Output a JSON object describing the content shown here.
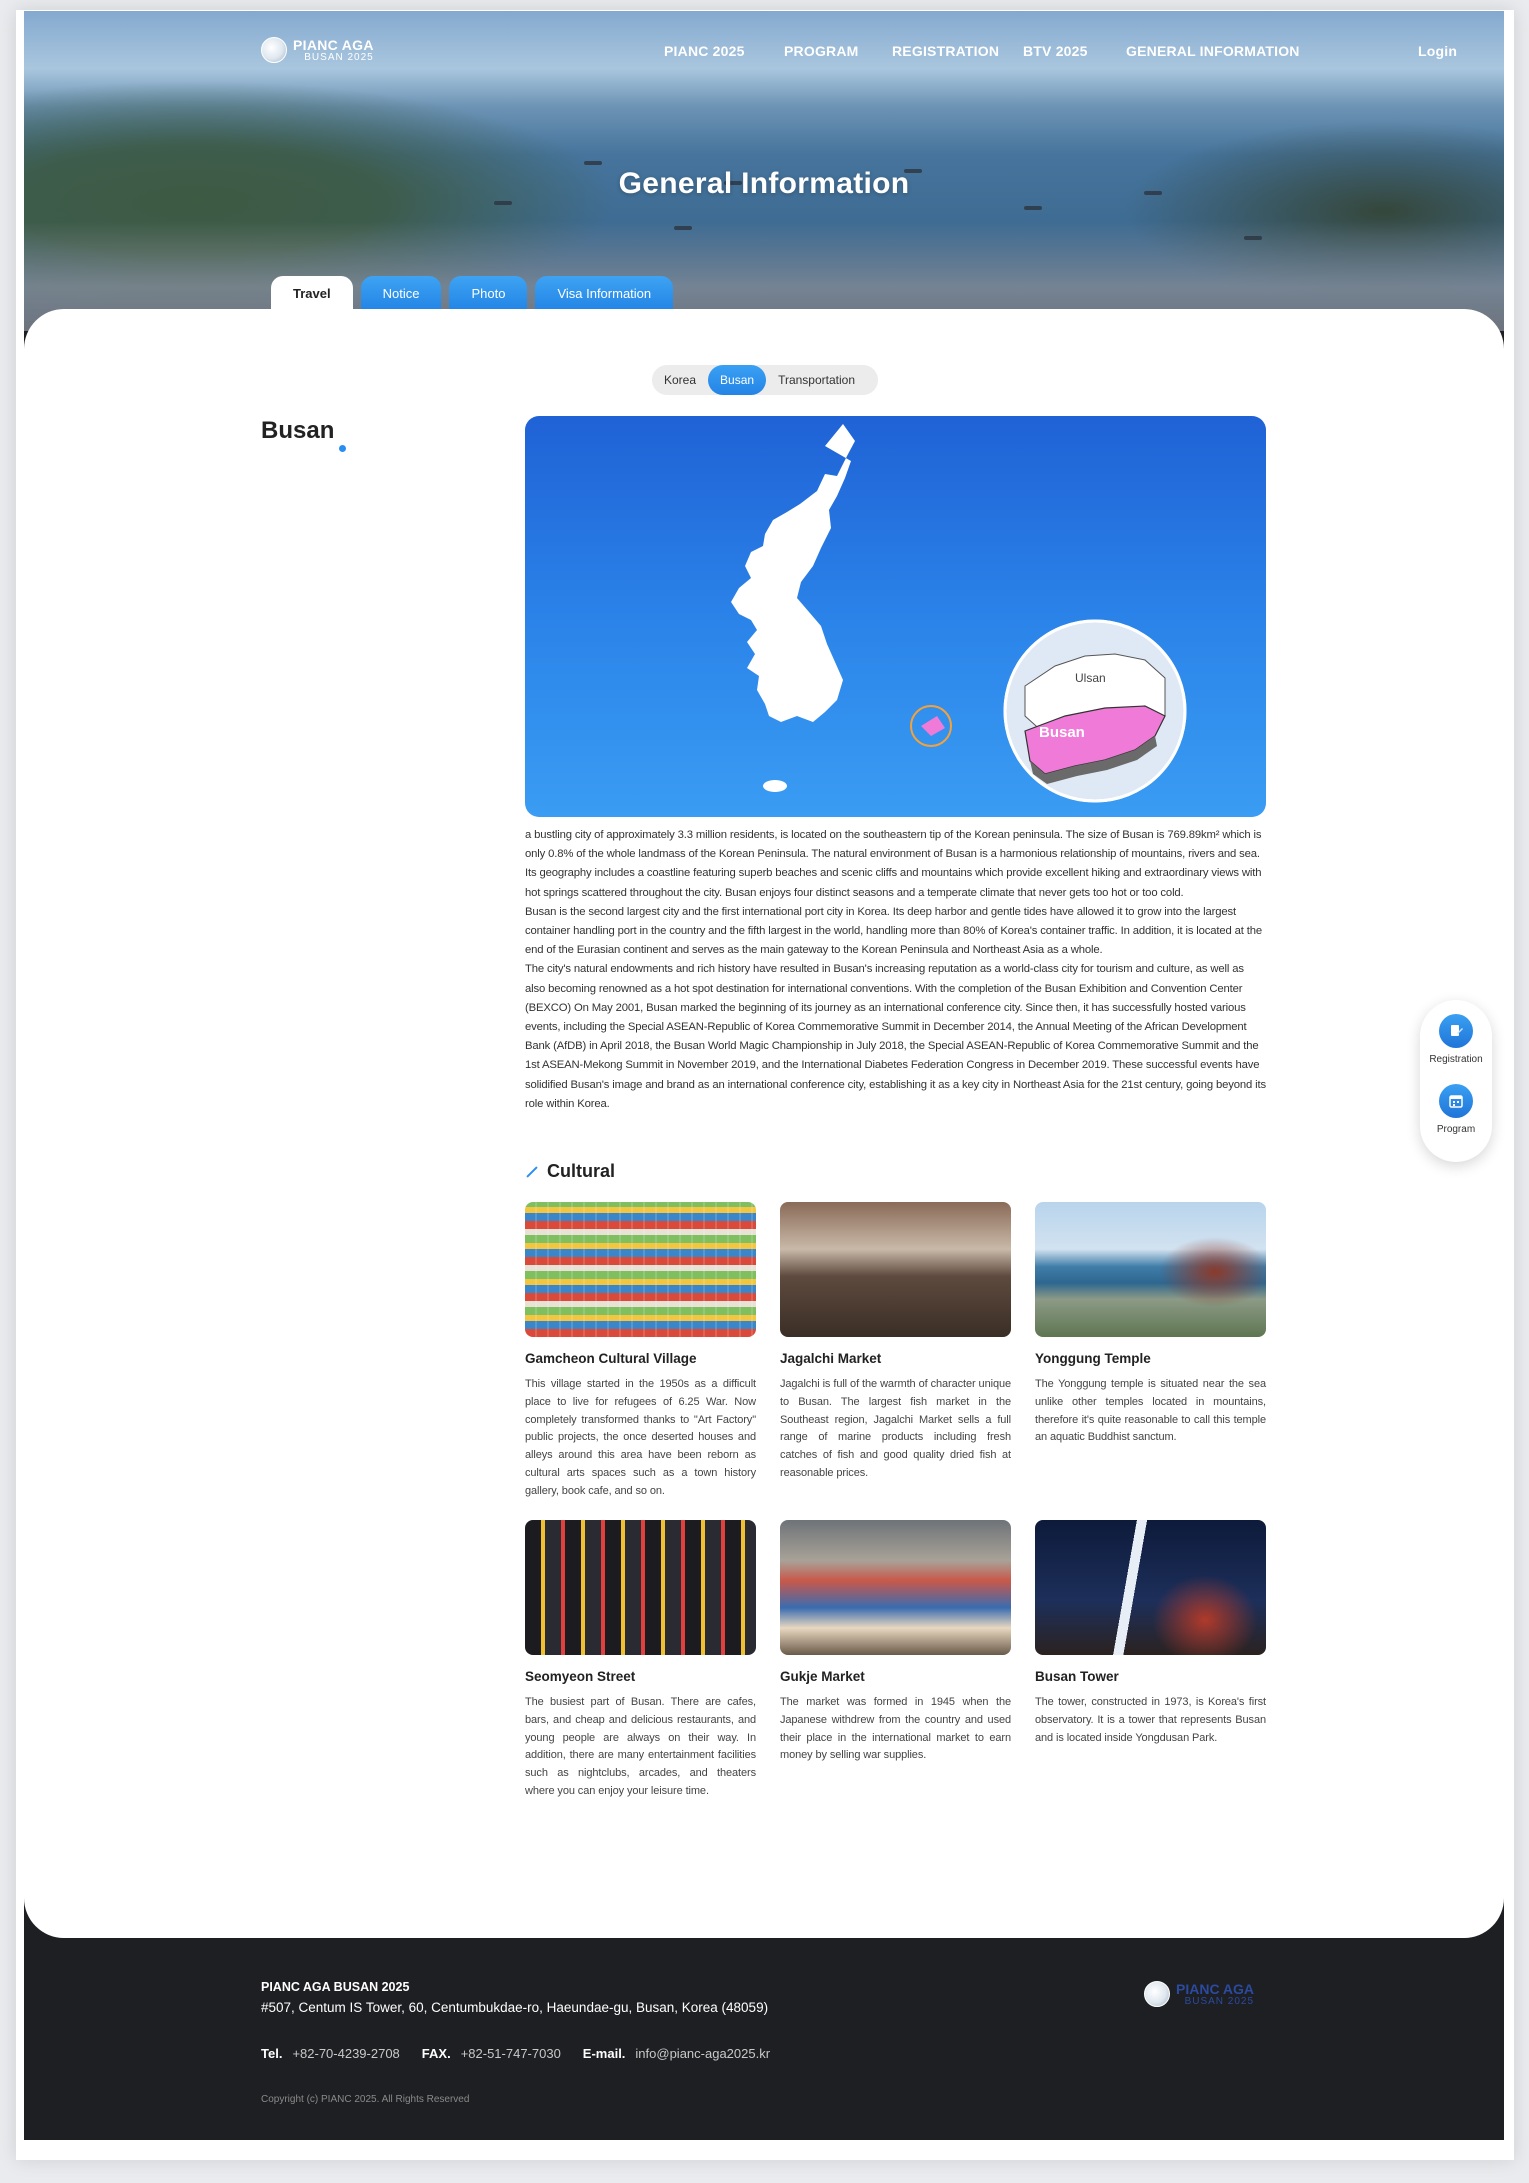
{
  "brand": {
    "line1": "PIANC AGA",
    "line2": "BUSAN 2025"
  },
  "nav": {
    "items": [
      "PIANC 2025",
      "PROGRAM",
      "REGISTRATION",
      "BTV 2025",
      "GENERAL INFORMATION"
    ],
    "login": "Login"
  },
  "hero": {
    "title": "General Information"
  },
  "tabs": [
    "Travel",
    "Notice",
    "Photo",
    "Visa Information"
  ],
  "subtabs": [
    "Korea",
    "Busan",
    "Transportation"
  ],
  "section": {
    "title": "Busan"
  },
  "map": {
    "label_ulsan": "Ulsan",
    "label_busan": "Busan"
  },
  "description": [
    "a bustling city of approximately 3.3 million residents, is located on the southeastern tip of the Korean peninsula. The size of Busan is 769.89km² which is only 0.8% of the whole landmass of the Korean Peninsula. The natural environment of Busan is a harmonious relationship of mountains, rivers and sea. Its geography includes a coastline featuring superb beaches and scenic cliffs and mountains which provide excellent hiking and extraordinary views with hot springs scattered throughout the city. Busan enjoys four distinct seasons and a temperate climate that never gets too hot or too cold.",
    "Busan is the second largest city and the first international port city in Korea. Its deep harbor and gentle tides have allowed it to grow into the largest container handling port in the country and the fifth largest in the world, handling more than 80% of Korea's container traffic. In addition, it is located at the end of the Eurasian continent and serves as the main gateway to the Korean Peninsula and Northeast Asia as a whole.",
    "The city's natural endowments and rich history have resulted in Busan's increasing reputation as a world-class city for tourism and culture, as well as also becoming renowned as a hot spot destination for international conventions. With the completion of the Busan Exhibition and Convention Center (BEXCO) On May 2001, Busan marked the beginning of its journey as an international conference city. Since then, it has successfully hosted various events, including the Special ASEAN-Republic of Korea Commemorative Summit in December 2014, the Annual Meeting of the African Development Bank (AfDB) in April 2018, the Busan World Magic Championship in July 2018, the Special ASEAN-Republic of Korea Commemorative Summit and the 1st ASEAN-Mekong Summit in November 2019, and the International Diabetes Federation Congress in December 2019. These successful events have solidified Busan's image and brand as an international conference city, establishing it as a key city in Northeast Asia for the 21st century, going beyond its role within Korea."
  ],
  "cultural": {
    "title": "Cultural",
    "items": [
      {
        "name": "Gamcheon Cultural Village",
        "text": "This village started in the 1950s as a difficult place to live for refugees of 6.25 War. Now completely transformed thanks to \"Art Factory\" public projects, the once deserted houses and alleys around this area have been reborn as cultural arts spaces such as a town history gallery, book cafe, and so on."
      },
      {
        "name": "Jagalchi Market",
        "text": "Jagalchi is full of the warmth of character unique to Busan. The largest fish market in the Southeast region, Jagalchi Market sells a full range of marine products including fresh catches of fish and good quality dried fish at reasonable prices."
      },
      {
        "name": "Yonggung Temple",
        "text": "The Yonggung temple is situated near the sea unlike other temples located in mountains, therefore it's quite reasonable to call this temple an aquatic Buddhist sanctum."
      },
      {
        "name": "Seomyeon Street",
        "text": "The busiest part of Busan. There are cafes, bars, and cheap and delicious restaurants, and young people are always on their way. In addition, there are many entertainment facilities such as nightclubs, arcades, and theaters where you can enjoy your leisure time."
      },
      {
        "name": "Gukje Market",
        "text": "The market was formed in 1945 when the Japanese withdrew from the country and used their place in the international market to earn money by selling war supplies."
      },
      {
        "name": "Busan Tower",
        "text": "The tower, constructed in 1973, is Korea's first observatory. It is a tower that represents Busan and is located inside Yongdusan Park."
      }
    ]
  },
  "quick": {
    "registration": "Registration",
    "program": "Program"
  },
  "footer": {
    "name": "PIANC AGA BUSAN 2025",
    "address": "#507, Centum IS Tower, 60, Centumbukdae-ro, Haeundae-gu, Busan, Korea (48059)",
    "tel_label": "Tel.",
    "tel": "+82-70-4239-2708",
    "fax_label": "FAX.",
    "fax": "+82-51-747-7030",
    "email_label": "E-mail.",
    "email": "info@pianc-aga2025.kr",
    "copyright": "Copyright (c) PIANC 2025. All Rights Reserved"
  },
  "colors": {
    "accent": "#2a8ef0",
    "footer_bg": "#1e1f22",
    "busan_highlight": "#f07ad8"
  }
}
